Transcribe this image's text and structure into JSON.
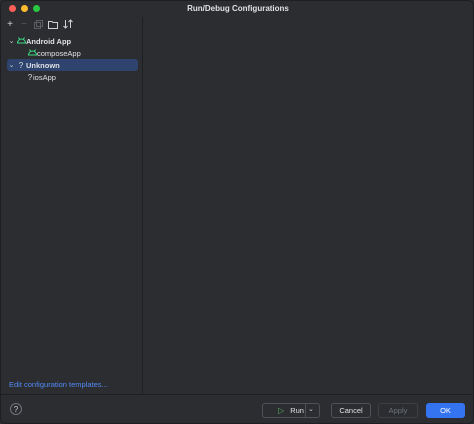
{
  "window": {
    "title": "Run/Debug Configurations"
  },
  "toolbar": {
    "add_icon": "plus-icon",
    "remove_icon": "minus-icon",
    "copy_icon": "copy-icon",
    "folder_icon": "folder-icon",
    "sort_icon": "sort-icon"
  },
  "tree": {
    "groups": [
      {
        "label": "Android App",
        "icon": "android-icon",
        "children": [
          {
            "label": "composeApp",
            "icon": "android-icon"
          }
        ]
      },
      {
        "label": "Unknown",
        "icon": "question-icon",
        "children": [
          {
            "label": "iosApp",
            "icon": "question-icon"
          }
        ]
      }
    ]
  },
  "links": {
    "edit_templates": "Edit configuration templates..."
  },
  "buttons": {
    "run": "Run",
    "cancel": "Cancel",
    "apply": "Apply",
    "ok": "OK",
    "help": "?"
  },
  "colors": {
    "accent": "#3574f0",
    "selection": "#2e436e",
    "link": "#548af7",
    "android": "#3ddc84"
  }
}
